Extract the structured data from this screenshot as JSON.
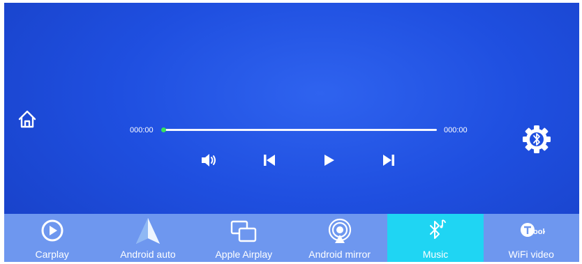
{
  "player": {
    "time_elapsed": "000:00",
    "time_total": "000:00",
    "progress": 0
  },
  "colors": {
    "background": "#1f4fe0",
    "tab_bar": "#6e97ef",
    "tab_active": "#1fd5f3",
    "progress_knob": "#37e15d"
  },
  "tabs": [
    {
      "id": "carplay",
      "label": "Carplay",
      "icon": "carplay-play-icon",
      "active": false
    },
    {
      "id": "android-auto",
      "label": "Android auto",
      "icon": "android-auto-icon",
      "active": false
    },
    {
      "id": "apple-airplay",
      "label": "Apple Airplay",
      "icon": "airplay-screens-icon",
      "active": false
    },
    {
      "id": "android-mirror",
      "label": "Android mirror",
      "icon": "mirror-cast-icon",
      "active": false
    },
    {
      "id": "music",
      "label": "Music",
      "icon": "bluetooth-music-icon",
      "active": true
    },
    {
      "id": "wifi-video",
      "label": "WiFi video",
      "icon": "tlook-icon",
      "active": false
    }
  ]
}
